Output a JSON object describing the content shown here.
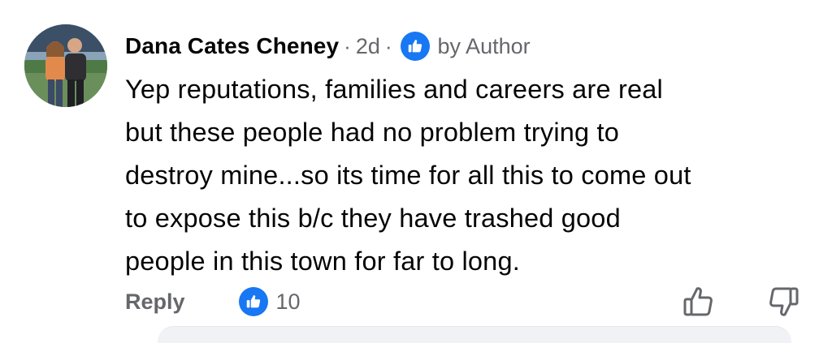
{
  "comment": {
    "author": "Dana Cates Cheney",
    "separator": "·",
    "time": "2d",
    "author_label": "by Author",
    "lines": [
      "Yep reputations, families and careers are real",
      "but these people had no problem trying to",
      "destroy mine...so its time for all this to come out",
      "to expose this b/c they have trashed good",
      "people in this town for far to long."
    ]
  },
  "actions": {
    "reply_label": "Reply",
    "like_count": "10"
  },
  "colors": {
    "brand": "#1877f2",
    "secondary_text": "#65676b",
    "primary_text": "#050505"
  },
  "icons": {
    "author_badge": "like-thumb-icon",
    "reaction": "like-reaction-icon",
    "like_button": "thumb-up-outline-icon",
    "dislike_button": "thumb-down-outline-icon"
  }
}
